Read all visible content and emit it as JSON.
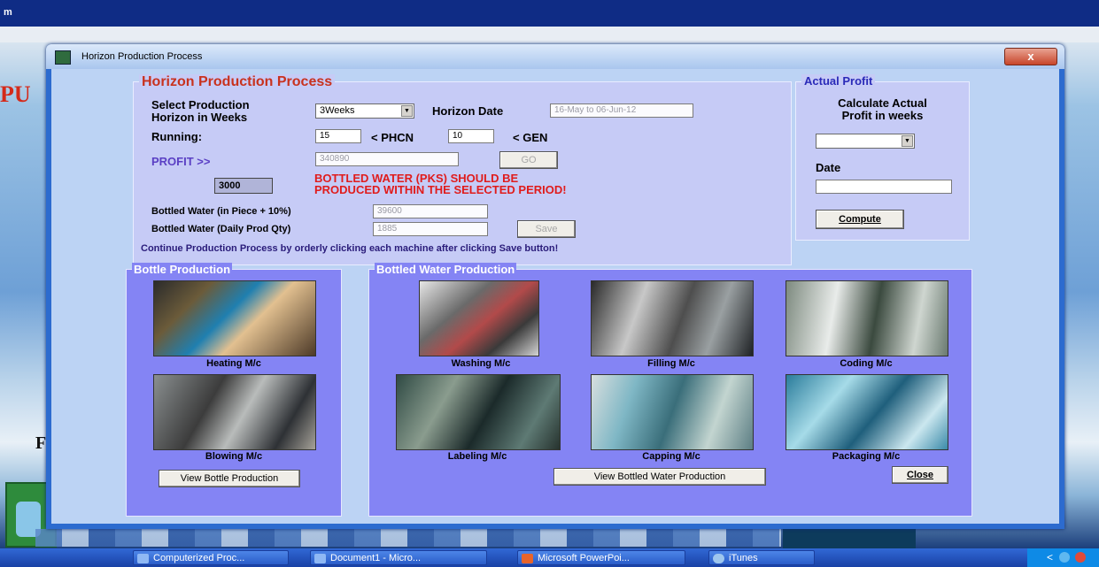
{
  "background": {
    "top_title": "m",
    "red_text": "PU",
    "f_text": "F"
  },
  "window": {
    "title": "Horizon Production Process",
    "close_label": "x",
    "main": {
      "legend": "Horizon Production Process",
      "select_label_1": "Select Production",
      "select_label_2": "Horizon in Weeks",
      "weeks_value": "3Weeks",
      "horizon_date_label": "Horizon Date",
      "horizon_date_value": "16-May to 06-Jun-12",
      "running_label": "Running:",
      "phcn_value": "15",
      "phcn_label": "< PHCN",
      "gen_value": "10",
      "gen_label": "< GEN",
      "profit_label": "PROFIT >>",
      "profit_value": "340890",
      "go_label": "GO",
      "qty_value": "3000",
      "warning_1": "BOTTLED WATER (PKS) SHOULD BE",
      "warning_2": "PRODUCED WITHIN THE SELECTED PERIOD!",
      "piece_label": "Bottled Water (in Piece + 10%)",
      "piece_value": "39600",
      "daily_label": "Bottled Water (Daily Prod Qty)",
      "daily_value": "1885",
      "save_label": "Save",
      "instructions": "Continue Production Process by orderly clicking each machine after clicking Save button!"
    },
    "actual_profit": {
      "legend": "Actual Profit",
      "calc_label_1": "Calculate Actual",
      "calc_label_2": "Profit in weeks",
      "weeks_value": "",
      "date_label": "Date",
      "date_value": "",
      "compute_label": "Compute"
    },
    "bottle_production": {
      "legend": "Bottle Production",
      "heating_label": "Heating M/c",
      "blowing_label": "Blowing M/c",
      "view_button": "View Bottle Production"
    },
    "water_production": {
      "legend": "Bottled Water Production",
      "washing_label": "Washing M/c",
      "filling_label": "Filling M/c",
      "coding_label": "Coding M/c",
      "labeling_label": "Labeling M/c",
      "capping_label": "Capping M/c",
      "packaging_label": "Packaging M/c",
      "view_button": "View Bottled Water Production",
      "close_button": "Close"
    }
  },
  "taskbar": {
    "items": [
      {
        "label": "Computerized Proc..."
      },
      {
        "label": "Document1 - Micro..."
      },
      {
        "label": "Microsoft PowerPoi..."
      },
      {
        "label": "iTunes"
      }
    ],
    "tray_text": "<"
  }
}
